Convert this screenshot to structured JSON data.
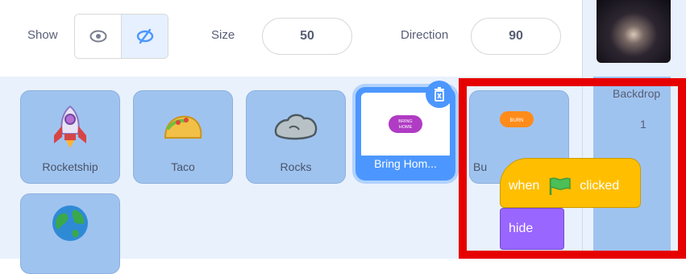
{
  "sprite_info": {
    "show_label": "Show",
    "size_label": "Size",
    "size_value": "50",
    "direction_label": "Direction",
    "direction_value": "90",
    "show_visible_icon": "eye-icon",
    "show_hidden_icon": "eye-slash-icon",
    "hidden_selected": true
  },
  "sprites": [
    {
      "name": "Rocketship",
      "icon": "rocket-icon"
    },
    {
      "name": "Taco",
      "icon": "taco-icon"
    },
    {
      "name": "Rocks",
      "icon": "rock-icon"
    },
    {
      "name": "Bring Hom...",
      "icon": "bring-home-button-icon",
      "selected": true,
      "thumb_text_line1": "BRING",
      "thumb_text_line2": "HOME"
    },
    {
      "name": "Bu",
      "icon": "button-icon",
      "thumb_text": "BURN"
    },
    {
      "name": "",
      "icon": "earth-icon"
    }
  ],
  "stage": {
    "backdrop_label": "Backdrop",
    "backdrop_count": "1"
  },
  "blocks": {
    "hat_when": "when",
    "hat_clicked": "clicked",
    "hat_icon": "green-flag-icon",
    "hide": "hide"
  },
  "colors": {
    "selected": "#4c97ff",
    "tile": "#9fc3ef",
    "events_block": "#ffbf00",
    "looks_block": "#9966ff",
    "highlight": "#e60000"
  }
}
